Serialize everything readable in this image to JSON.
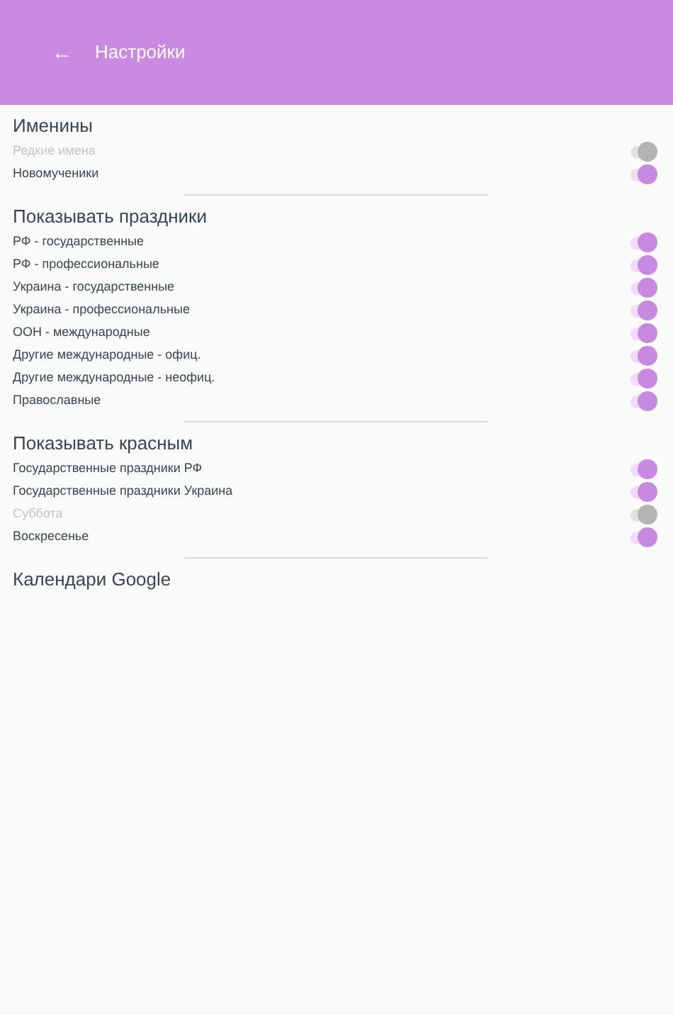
{
  "app_bar": {
    "back_icon": "←",
    "title": "Настройки"
  },
  "sections": [
    {
      "title": "Именины",
      "items": [
        {
          "label": "Редкие имена",
          "on": false
        },
        {
          "label": "Новомученики",
          "on": true
        }
      ]
    },
    {
      "title": "Показывать праздники",
      "items": [
        {
          "label": "РФ - государственные",
          "on": true
        },
        {
          "label": "РФ - профессиональные",
          "on": true
        },
        {
          "label": "Украина - государственные",
          "on": true
        },
        {
          "label": "Украина - профессиональные",
          "on": true
        },
        {
          "label": "ООН - международные",
          "on": true
        },
        {
          "label": "Другие международные - офиц.",
          "on": true
        },
        {
          "label": "Другие международные - неофиц.",
          "on": true
        },
        {
          "label": "Православные",
          "on": true
        }
      ]
    },
    {
      "title": "Показывать красным",
      "items": [
        {
          "label": "Государственные праздники РФ",
          "on": true
        },
        {
          "label": "Государственные праздники Украина",
          "on": true
        },
        {
          "label": "Суббота",
          "on": false
        },
        {
          "label": "Воскресенье",
          "on": true
        }
      ]
    },
    {
      "title": "Календари Google"
    }
  ]
}
